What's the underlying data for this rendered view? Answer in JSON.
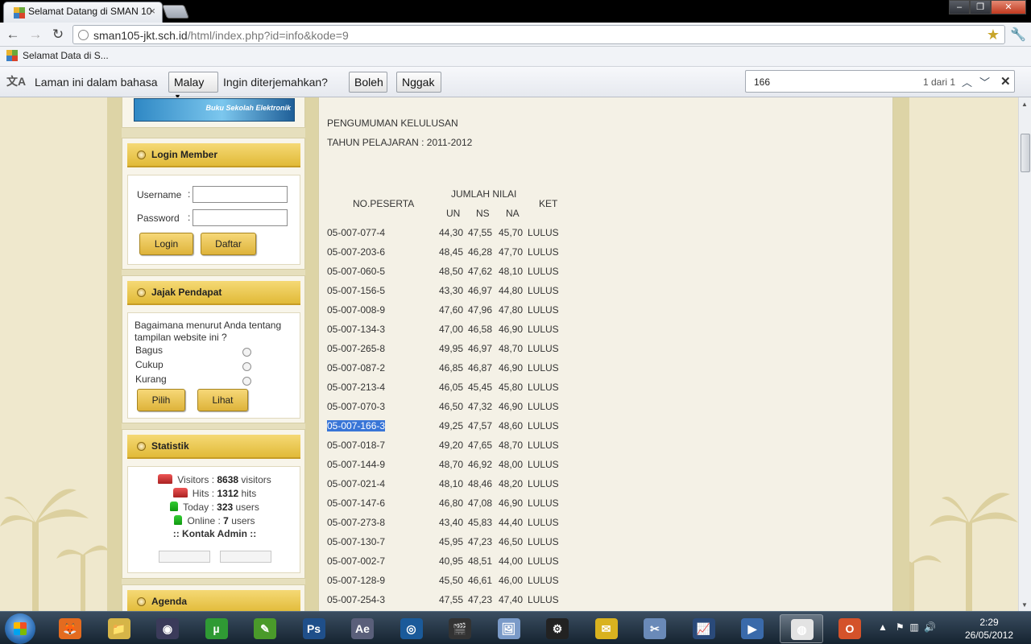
{
  "browser": {
    "tab_title": "Selamat Datang di SMAN 10",
    "url_host": "sman105-jkt.sch.id",
    "url_path": "/html/index.php?id=info&kode=9",
    "bookmark_label": "Selamat Data    di S..."
  },
  "translate_bar": {
    "prompt": "Laman ini dalam bahasa",
    "language": "Malay",
    "question": "Ingin diterjemahkan?",
    "yes_label": "Boleh",
    "no_label": "Nggak"
  },
  "find_bar": {
    "query": "166",
    "count": "1 dari 1"
  },
  "sidebar": {
    "banner_text": "Buku Sekolah Elektronik",
    "login": {
      "title": "Login Member",
      "username_label": "Username",
      "password_label": "Password",
      "login_button": "Login",
      "register_button": "Daftar"
    },
    "poll": {
      "title": "Jajak Pendapat",
      "question": "Bagaimana menurut Anda tentang tampilan website ini ?",
      "options": [
        "Bagus",
        "Cukup",
        "Kurang"
      ],
      "choose_button": "Pilih",
      "view_button": "Lihat"
    },
    "stats": {
      "title": "Statistik",
      "visitors_label": "Visitors :",
      "visitors_value": "8638",
      "visitors_unit": "visitors",
      "hits_label": "Hits :",
      "hits_value": "1312",
      "hits_unit": "hits",
      "today_label": "Today :",
      "today_value": "323",
      "today_unit": "users",
      "online_label": "Online :",
      "online_value": "7",
      "online_unit": "users",
      "contact": ":: Kontak Admin ::"
    },
    "agenda_title": "Agenda"
  },
  "content": {
    "heading": "PENGUMUMAN KELULUSAN",
    "year": "TAHUN PELAJARAN : 2011-2012",
    "col_no": "NO.PESERTA",
    "col_group": "JUMLAH NILAI",
    "col_un": "UN",
    "col_ns": "NS",
    "col_na": "NA",
    "col_ket": "KET",
    "rows": [
      {
        "no": "05-007-077-4",
        "un": "44,30",
        "ns": "47,55",
        "na": "45,70",
        "ket": "LULUS"
      },
      {
        "no": "05-007-203-6",
        "un": "48,45",
        "ns": "46,28",
        "na": "47,70",
        "ket": "LULUS"
      },
      {
        "no": "05-007-060-5",
        "un": "48,50",
        "ns": "47,62",
        "na": "48,10",
        "ket": "LULUS"
      },
      {
        "no": "05-007-156-5",
        "un": "43,30",
        "ns": "46,97",
        "na": "44,80",
        "ket": "LULUS"
      },
      {
        "no": "05-007-008-9",
        "un": "47,60",
        "ns": "47,96",
        "na": "47,80",
        "ket": "LULUS"
      },
      {
        "no": "05-007-134-3",
        "un": "47,00",
        "ns": "46,58",
        "na": "46,90",
        "ket": "LULUS"
      },
      {
        "no": "05-007-265-8",
        "un": "49,95",
        "ns": "46,97",
        "na": "48,70",
        "ket": "LULUS"
      },
      {
        "no": "05-007-087-2",
        "un": "46,85",
        "ns": "46,87",
        "na": "46,90",
        "ket": "LULUS"
      },
      {
        "no": "05-007-213-4",
        "un": "46,05",
        "ns": "45,45",
        "na": "45,80",
        "ket": "LULUS"
      },
      {
        "no": "05-007-070-3",
        "un": "46,50",
        "ns": "47,32",
        "na": "46,90",
        "ket": "LULUS"
      },
      {
        "no": "05-007-166-3",
        "un": "49,25",
        "ns": "47,57",
        "na": "48,60",
        "ket": "LULUS"
      },
      {
        "no": "05-007-018-7",
        "un": "49,20",
        "ns": "47,65",
        "na": "48,70",
        "ket": "LULUS"
      },
      {
        "no": "05-007-144-9",
        "un": "48,70",
        "ns": "46,92",
        "na": "48,00",
        "ket": "LULUS"
      },
      {
        "no": "05-007-021-4",
        "un": "48,10",
        "ns": "48,46",
        "na": "48,20",
        "ket": "LULUS"
      },
      {
        "no": "05-007-147-6",
        "un": "46,80",
        "ns": "47,08",
        "na": "46,90",
        "ket": "LULUS"
      },
      {
        "no": "05-007-273-8",
        "un": "43,40",
        "ns": "45,83",
        "na": "44,40",
        "ket": "LULUS"
      },
      {
        "no": "05-007-130-7",
        "un": "45,95",
        "ns": "47,23",
        "na": "46,50",
        "ket": "LULUS"
      },
      {
        "no": "05-007-002-7",
        "un": "40,95",
        "ns": "48,51",
        "na": "44,00",
        "ket": "LULUS"
      },
      {
        "no": "05-007-128-9",
        "un": "45,50",
        "ns": "46,61",
        "na": "46,00",
        "ket": "LULUS"
      },
      {
        "no": "05-007-254-3",
        "un": "47,55",
        "ns": "47,23",
        "na": "47,40",
        "ket": "LULUS"
      }
    ]
  },
  "taskbar": {
    "apps": [
      "firefox",
      "explorer",
      "media-center",
      "utorrent",
      "inkscape",
      "photoshop",
      "after-effects",
      "media-player",
      "movie-maker",
      "picture-viewer",
      "winamp-like",
      "chat",
      "snipping",
      "task-manager",
      "video",
      "chrome",
      "office"
    ],
    "time": "2:29",
    "date": "26/05/2012"
  }
}
